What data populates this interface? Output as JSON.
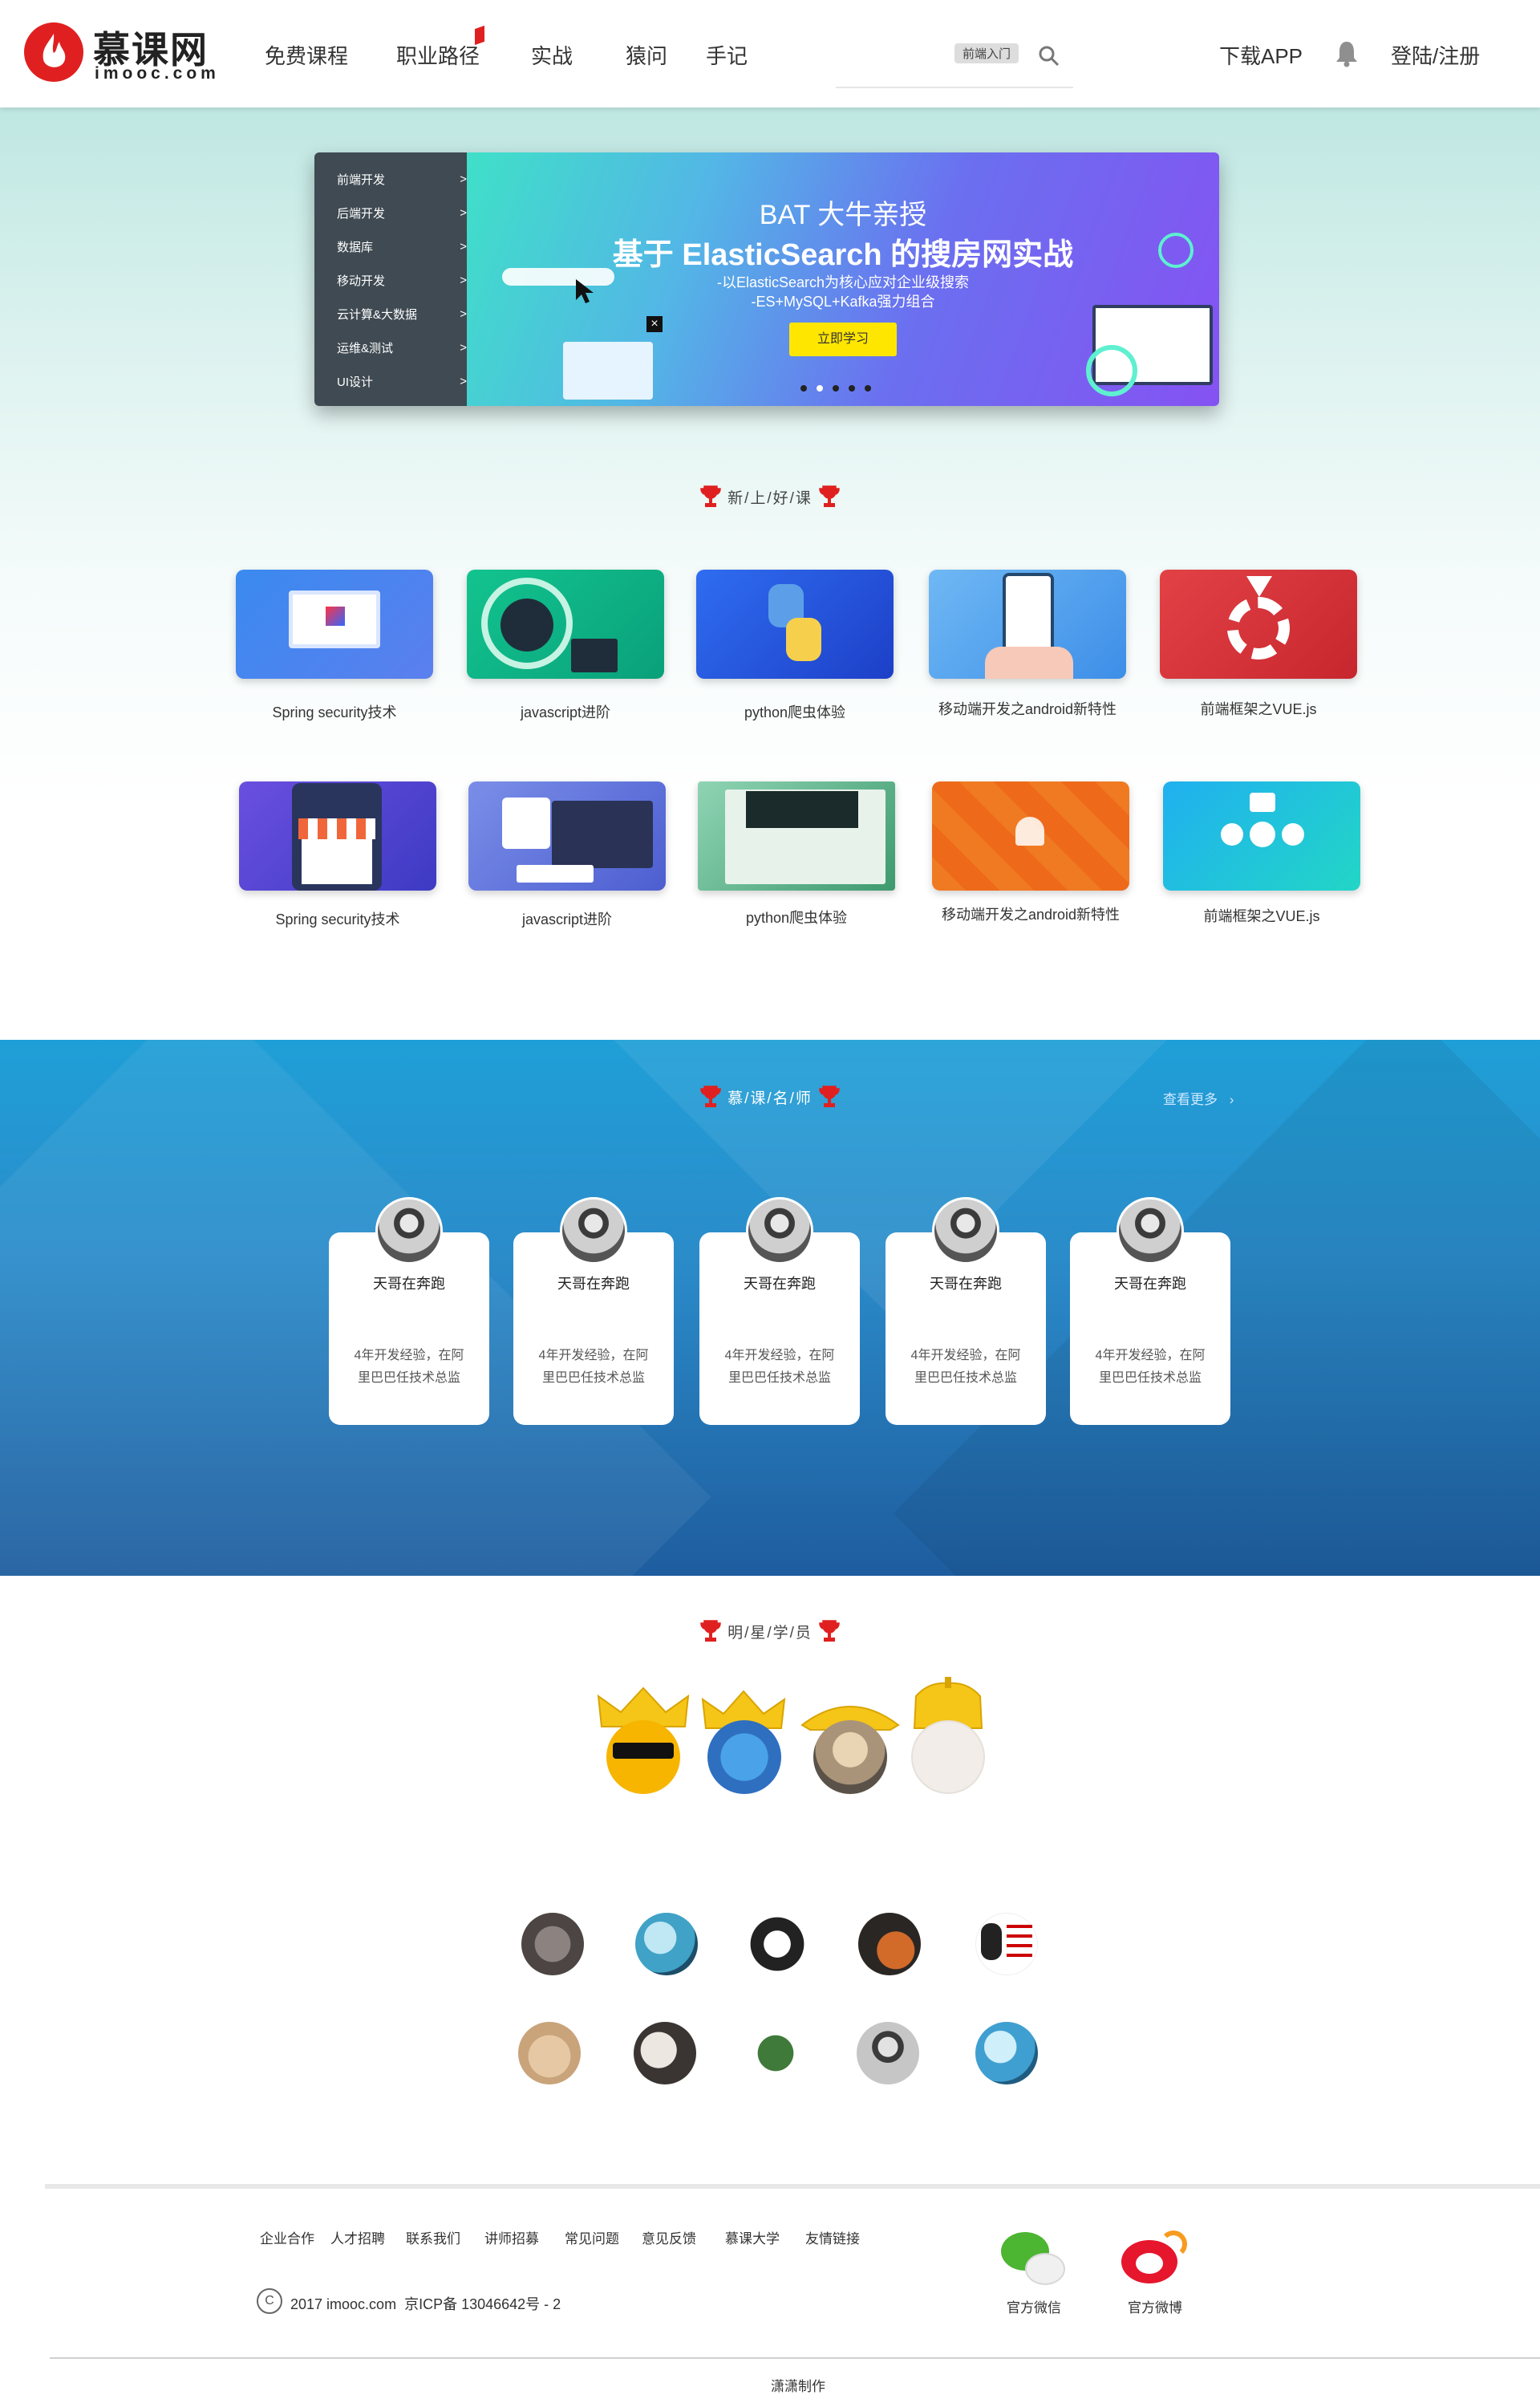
{
  "header": {
    "logo_main": "慕课网",
    "logo_sub": "imooc.com",
    "nav": [
      "免费课程",
      "职业路径",
      "实战",
      "猿问",
      "手记"
    ],
    "search_tag": "前端入门",
    "download": "下载APP",
    "login": "登陆/注册",
    "accent": "#e02020"
  },
  "banner": {
    "menu": [
      {
        "label": "前端开发",
        "arrow": ">"
      },
      {
        "label": "后端开发",
        "arrow": ">"
      },
      {
        "label": "数据库",
        "arrow": ">"
      },
      {
        "label": "移动开发",
        "arrow": ">"
      },
      {
        "label": "云计算&大数据",
        "arrow": ">"
      },
      {
        "label": "运维&测试",
        "arrow": ">"
      },
      {
        "label": "UI设计",
        "arrow": ">"
      }
    ],
    "title1": "BAT 大牛亲授",
    "title2": "基于 ElasticSearch 的搜房网实战",
    "sub1": "-以ElasticSearch为核心应对企业级搜索",
    "sub2": "-ES+MySQL+Kafka强力组合",
    "cta": "立即学习",
    "slide_current": 2,
    "slide_total": 5
  },
  "new_courses": {
    "title": "新/上/好/课",
    "row1": [
      {
        "name": "Spring security技术",
        "color": "#3a78e6"
      },
      {
        "name": "javascript进阶",
        "color": "#16b08a"
      },
      {
        "name": "python爬虫体验",
        "color": "#2b59d9"
      },
      {
        "name": "移动端开发之android新特性",
        "color": "#4aa3ea"
      },
      {
        "name": "前端框架之VUE.js",
        "color": "#d8353d"
      }
    ],
    "row2": [
      {
        "name": "Spring security技术",
        "color": "#6a4fe0"
      },
      {
        "name": "javascript进阶",
        "color": "#5b6ed8"
      },
      {
        "name": "python爬虫体验",
        "color": "#3e9a6e"
      },
      {
        "name": "移动端开发之android新特性",
        "color": "#f0751f"
      },
      {
        "name": "前端框架之VUE.js",
        "color": "#1f9fe0"
      }
    ]
  },
  "teachers": {
    "title": "慕/课/名/师",
    "more": "查看更多",
    "list": [
      {
        "name": "天哥在奔跑",
        "desc": "4年开发经验，在阿里巴巴任技术总监"
      },
      {
        "name": "天哥在奔跑",
        "desc": "4年开发经验，在阿里巴巴任技术总监"
      },
      {
        "name": "天哥在奔跑",
        "desc": "4年开发经验，在阿里巴巴任技术总监"
      },
      {
        "name": "天哥在奔跑",
        "desc": "4年开发经验，在阿里巴巴任技术总监"
      },
      {
        "name": "天哥在奔跑",
        "desc": "4年开发经验，在阿里巴巴任技术总监"
      }
    ]
  },
  "students": {
    "title": "明/星/学/员"
  },
  "footer": {
    "links": [
      "企业合作",
      "人才招聘",
      "联系我们",
      "讲师招募",
      "常见问题",
      "意见反馈",
      "慕课大学",
      "友情链接"
    ],
    "copyright_symbol": "C",
    "copyright": "2017 imooc.com  京ICP备 13046642号 - 2",
    "wechat": "官方微信",
    "weibo": "官方微博",
    "credit": "潇潇制作"
  }
}
